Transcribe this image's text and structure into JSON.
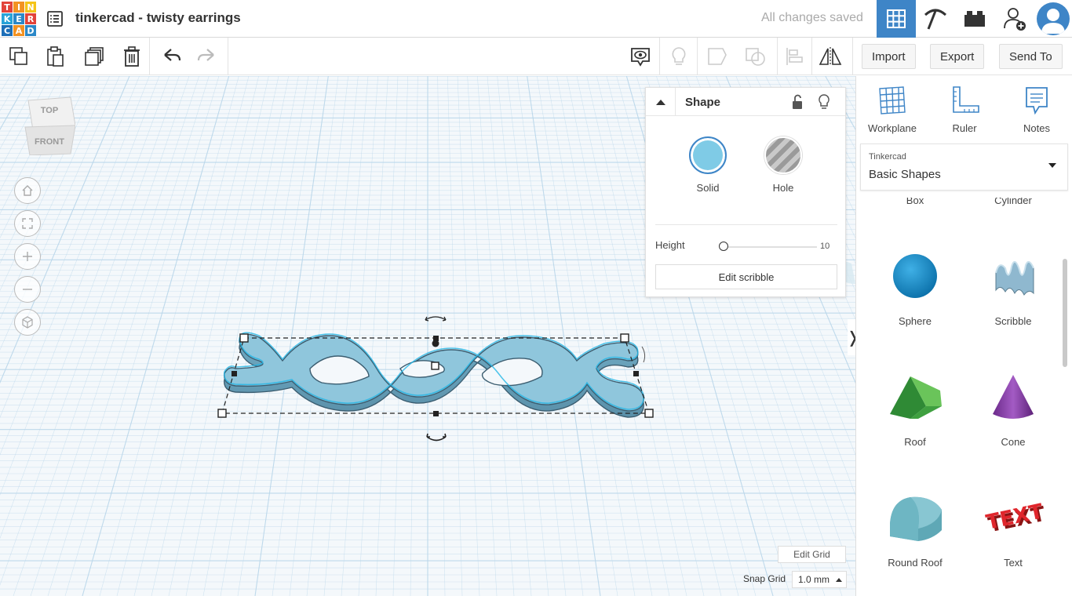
{
  "app": {
    "logo_letters": [
      "T",
      "I",
      "N",
      "K",
      "E",
      "R",
      "C",
      "A",
      "D"
    ],
    "logo_colors": [
      "#e2433a",
      "#f39222",
      "#f5c418",
      "#28a3d8",
      "#2b88c8",
      "#e2433a",
      "#1d6fb8",
      "#f39222",
      "#2b88c8"
    ],
    "title": "tinkercad - twisty earrings",
    "save_status": "All changes saved"
  },
  "toolbar": {
    "import_label": "Import",
    "export_label": "Export",
    "send_to_label": "Send To"
  },
  "viewcube": {
    "top_label": "TOP",
    "front_label": "FRONT"
  },
  "inspector": {
    "title": "Shape",
    "solid_label": "Solid",
    "hole_label": "Hole",
    "solid_color": "#7fcbe6",
    "height_label": "Height",
    "height_value": "10",
    "edit_button": "Edit scribble"
  },
  "grid": {
    "edit_grid_label": "Edit Grid",
    "snap_label": "Snap Grid",
    "snap_value": "1.0 mm"
  },
  "panel": {
    "tools": [
      {
        "label": "Workplane",
        "icon": "workplane-icon"
      },
      {
        "label": "Ruler",
        "icon": "ruler-icon"
      },
      {
        "label": "Notes",
        "icon": "notes-icon"
      }
    ],
    "library_source": "Tinkercad",
    "library_name": "Basic Shapes",
    "shapes": [
      {
        "label": "Box"
      },
      {
        "label": "Cylinder"
      },
      {
        "label": "Sphere"
      },
      {
        "label": "Scribble"
      },
      {
        "label": "Roof"
      },
      {
        "label": "Cone"
      },
      {
        "label": "Round Roof"
      },
      {
        "label": "Text"
      }
    ]
  },
  "colors": {
    "accent": "#3e85c7",
    "shape_blue": "#8fc6dc",
    "grid_line": "#b9d6ea"
  }
}
